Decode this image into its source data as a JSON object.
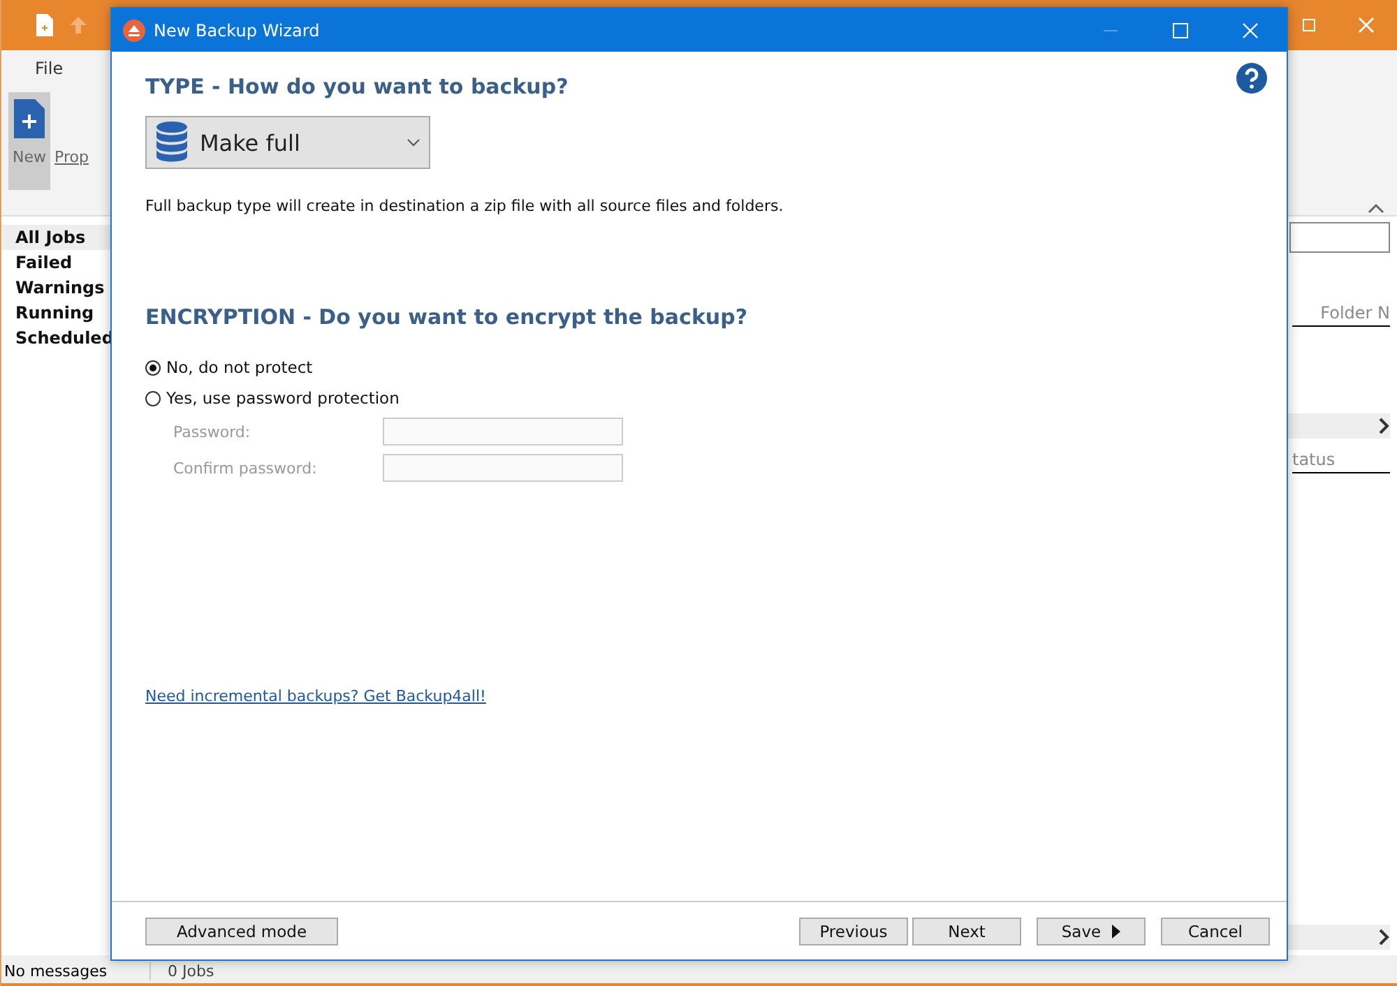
{
  "app": {
    "ribbon_tabs": [
      {
        "label": "File",
        "selected": false
      }
    ],
    "ribbon_buttons": [
      {
        "label": "New",
        "selected": true
      },
      {
        "label": "Prop",
        "selected": false
      }
    ],
    "sidebar": {
      "items": [
        {
          "label": "All Jobs",
          "selected": true
        },
        {
          "label": "Failed",
          "selected": false
        },
        {
          "label": "Warnings",
          "selected": false
        },
        {
          "label": "Running",
          "selected": false
        },
        {
          "label": "Scheduled",
          "selected": false
        }
      ]
    },
    "columns": [
      "Folder N",
      "tatus"
    ],
    "status_bar": [
      "No messages",
      "0 Jobs"
    ]
  },
  "dialog": {
    "title": "New Backup Wizard",
    "type_heading": "TYPE - How do you want to backup?",
    "backup_type": "Make full",
    "type_description": "Full backup type will create in destination a zip file with all source files and folders.",
    "encryption_heading": "ENCRYPTION - Do you want to encrypt the backup?",
    "options": [
      {
        "label": "No, do not protect",
        "selected": true
      },
      {
        "label": "Yes, use password protection",
        "selected": false
      }
    ],
    "fields": [
      {
        "label": "Password:",
        "disabled": true
      },
      {
        "label": "Confirm password:",
        "disabled": true
      }
    ],
    "link": "Need incremental backups? Get Backup4all!",
    "left_buttons": [
      {
        "label": "Advanced mode"
      }
    ],
    "right_buttons": [
      {
        "label": "Previous",
        "kind": "plain"
      },
      {
        "label": "Next",
        "kind": "plain"
      },
      {
        "label": "Save",
        "kind": "menu"
      },
      {
        "label": "Cancel",
        "kind": "plain"
      }
    ]
  }
}
